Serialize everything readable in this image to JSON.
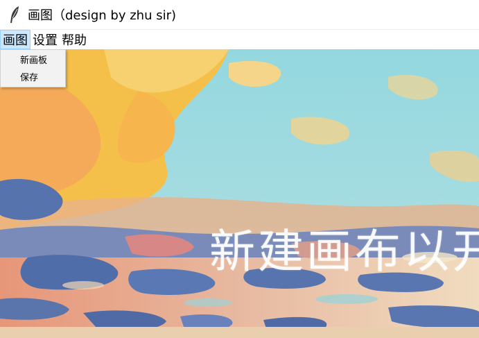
{
  "window": {
    "title": "画图（design by zhu sir)",
    "icon": "feather-icon"
  },
  "menubar": {
    "items": [
      {
        "label": "画图",
        "active": true
      },
      {
        "label": "设置",
        "active": false
      },
      {
        "label": "帮助",
        "active": false
      }
    ]
  },
  "dropdown": {
    "items": [
      {
        "label": "新画板"
      },
      {
        "label": "保存"
      }
    ]
  },
  "canvas": {
    "overlay_text": "新建画布以开",
    "colors": {
      "sky": "#8fd3dc",
      "yellow": "#f6c24a",
      "orange": "#f39a5a",
      "blue": "#5a77b0",
      "pink": "#e58a8e",
      "cream": "#f6e6c4"
    }
  }
}
